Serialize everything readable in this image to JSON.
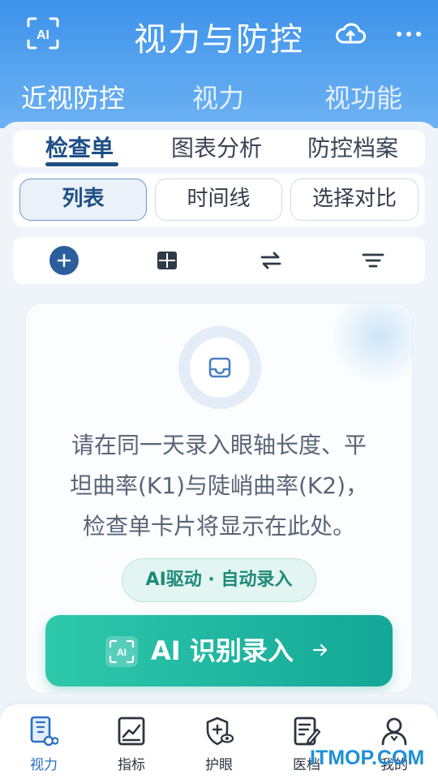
{
  "header": {
    "title": "视力与防控",
    "icons": [
      "ai-scan-icon",
      "cloud-upload-icon",
      "more-icon"
    ]
  },
  "main_tabs": [
    {
      "label": "近视防控",
      "active": true
    },
    {
      "label": "视力",
      "active": false
    },
    {
      "label": "视功能",
      "active": false
    }
  ],
  "sub_tabs": [
    {
      "label": "检查单",
      "active": true
    },
    {
      "label": "图表分析",
      "active": false
    },
    {
      "label": "防控档案",
      "active": false
    }
  ],
  "view_modes": [
    {
      "label": "列表",
      "active": true
    },
    {
      "label": "时间线",
      "active": false
    },
    {
      "label": "选择对比",
      "active": false
    }
  ],
  "toolbar": {
    "icons": [
      "add-icon",
      "grid-icon",
      "swap-icon",
      "filter-icon"
    ]
  },
  "empty_state": {
    "icon": "inbox-icon",
    "line1": "请在同一天录入眼轴长度、平",
    "line2": "坦曲率(K1)与陡峭曲率(K2)，",
    "line3": "检查单卡片将显示在此处。",
    "badge": "AI驱动 · 自动录入",
    "button_label": "AI 识别录入",
    "button_icon_text": "AI"
  },
  "bottom_nav": [
    {
      "label": "视力",
      "icon": "eye-chart-icon",
      "active": true
    },
    {
      "label": "指标",
      "icon": "trend-chart-icon",
      "active": false
    },
    {
      "label": "护眼",
      "icon": "eye-shield-icon",
      "active": false
    },
    {
      "label": "医档",
      "icon": "medical-record-icon",
      "active": false
    },
    {
      "label": "我的",
      "icon": "profile-icon",
      "active": false
    }
  ],
  "watermark": "ITMOP.COM",
  "colors": {
    "header_blue": "#3d92ea",
    "active_navy": "#1d4f86",
    "ai_green": "#14a797",
    "nav_active": "#2a6fc6"
  }
}
